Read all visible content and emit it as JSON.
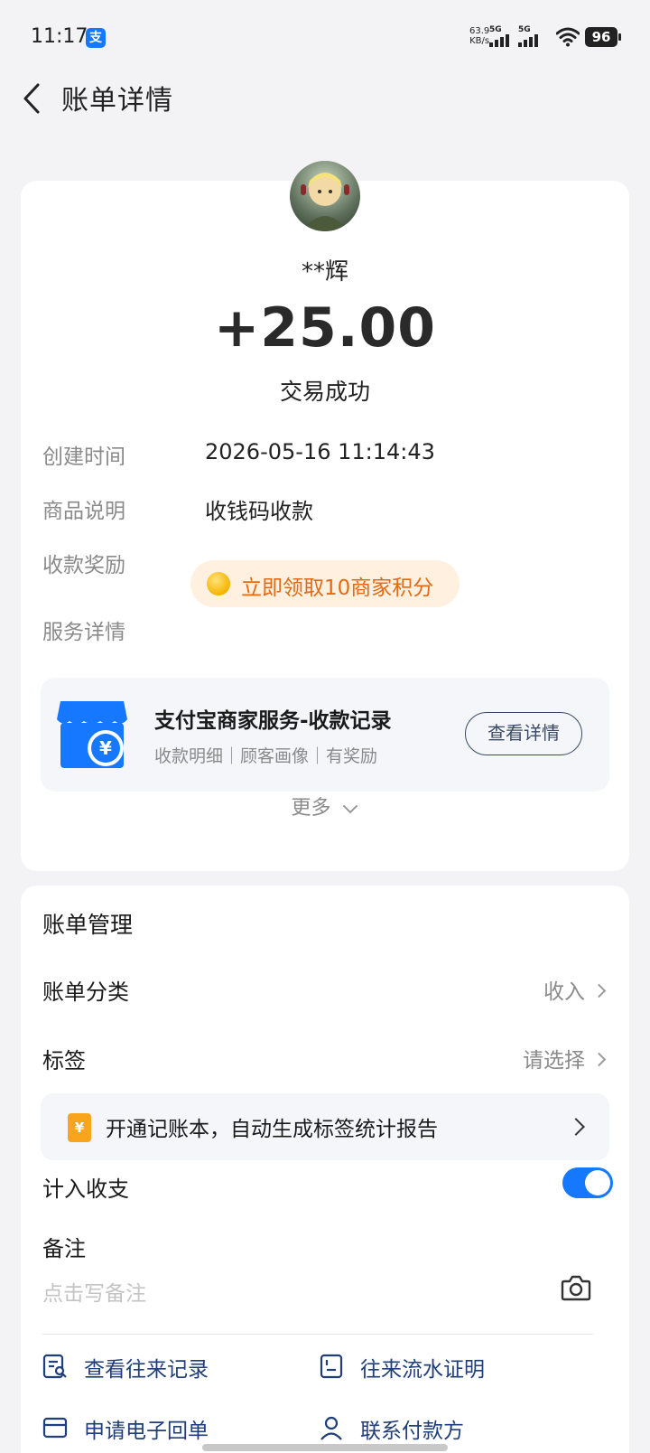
{
  "status_bar": {
    "time": "11:17",
    "app_badge": "支",
    "net_speed_value": "63.9",
    "net_speed_unit": "KB/s",
    "signal_1": "5G",
    "signal_2": "5G",
    "battery": "96"
  },
  "header": {
    "title": "账单详情"
  },
  "transaction": {
    "payer_name": "**辉",
    "amount": "+25.00",
    "status": "交易成功"
  },
  "details": [
    {
      "label": "创建时间",
      "value": "2026-05-16 11:14:43"
    },
    {
      "label": "商品说明",
      "value": "收钱码收款"
    },
    {
      "label": "收款奖励",
      "value": ""
    },
    {
      "label": "服务详情",
      "value": ""
    }
  ],
  "reward": {
    "text": "立即领取10商家积分"
  },
  "service": {
    "icon_symbol": "¥",
    "title": "支付宝商家服务-收款记录",
    "subtitle": "收款明细｜顾客画像｜有奖励",
    "button_label": "查看详情"
  },
  "more_label": "更多",
  "manage": {
    "title": "账单管理",
    "category_label": "账单分类",
    "category_value": "收入",
    "tag_label": "标签",
    "tag_value": "请选择",
    "ledger_icon_symbol": "¥",
    "ledger_banner": "开通记账本，自动生成标签统计报告",
    "include_label": "计入收支",
    "include_enabled": true,
    "note_label": "备注",
    "note_placeholder": "点击写备注",
    "links": [
      {
        "label": "查看往来记录",
        "icon": "record-search-icon"
      },
      {
        "label": "往来流水证明",
        "icon": "certificate-icon"
      },
      {
        "label": "申请电子回单",
        "icon": "receipt-icon"
      },
      {
        "label": "联系付款方",
        "icon": "contact-icon"
      }
    ]
  },
  "colors": {
    "accent": "#1677ff",
    "reward_text": "#e46a14",
    "reward_bg": "#fff0e0",
    "link": "#1f3e7a",
    "page_bg": "#f3f3f5"
  }
}
